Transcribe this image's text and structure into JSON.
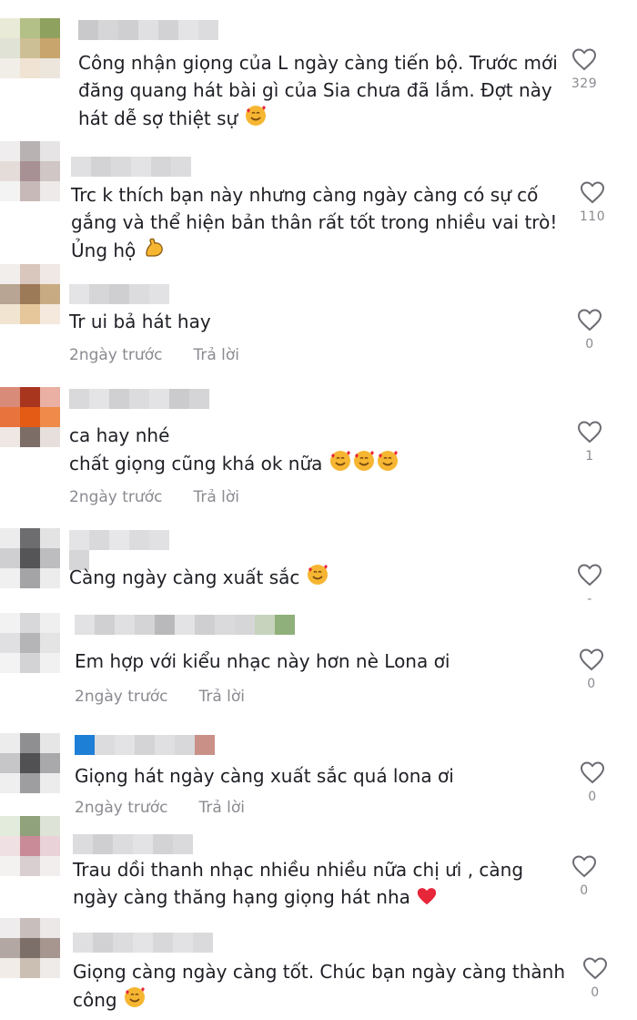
{
  "comments": [
    {
      "text": "Công nhận giọng của L ngày càng tiến bộ. Trước mới\nđăng quang hát bài gì của Sia chưa đã lắm. Đợt này\nhát dễ sợ thiệt sự",
      "emojis": [
        "smiling-hearts"
      ],
      "time": "",
      "reply": "",
      "likes": "329"
    },
    {
      "text": "Trc k thích bạn này nhưng càng ngày càng có sự cố\ngắng và thể hiện bản thân rất tốt trong nhiều vai trò!\nỦng hộ",
      "emojis": [
        "flexed-biceps"
      ],
      "time": "",
      "reply": "",
      "likes": "110"
    },
    {
      "text": "Tr ui bả hát hay",
      "emojis": [],
      "time": "2ngày trước",
      "reply": "Trả lời",
      "likes": "0"
    },
    {
      "text": "ca hay nhé\nchất giọng cũng khá ok nữa",
      "emojis": [
        "smiling-hearts",
        "smiling-hearts",
        "smiling-hearts"
      ],
      "time": "2ngày trước",
      "reply": "Trả lời",
      "likes": "1"
    },
    {
      "text": "Càng ngày càng xuất sắc",
      "emojis": [
        "smiling-hearts"
      ],
      "time": "",
      "reply": "",
      "likes": "-"
    },
    {
      "text": "Em hợp với kiểu nhạc này hơn nè Lona ơi",
      "emojis": [],
      "time": "2ngày trước",
      "reply": "Trả lời",
      "likes": "0"
    },
    {
      "text": "Giọng hát ngày càng xuất sắc quá lona ơi",
      "emojis": [],
      "time": "2ngày trước",
      "reply": "Trả lời",
      "likes": "0"
    },
    {
      "text": "Trau dồi thanh nhạc nhiều nhiều nữa chị ưi , càng\nngày càng thăng hạng giọng hát nha",
      "emojis": [
        "red-heart"
      ],
      "time": "",
      "reply": "",
      "likes": "0"
    },
    {
      "text": "Giọng càng ngày càng tốt. Chúc bạn ngày càng thành\ncông",
      "emojis": [
        "smiling-hearts"
      ],
      "time": "",
      "reply": "",
      "likes": "0"
    }
  ],
  "icons": {
    "like": "heart-outline-icon"
  },
  "colors": {
    "text": "#1e1f25",
    "muted": "#8a8b91",
    "heart_stroke": "#6b6c72",
    "emoji_face": "#f6b632",
    "emoji_heart": "#e8263a"
  }
}
